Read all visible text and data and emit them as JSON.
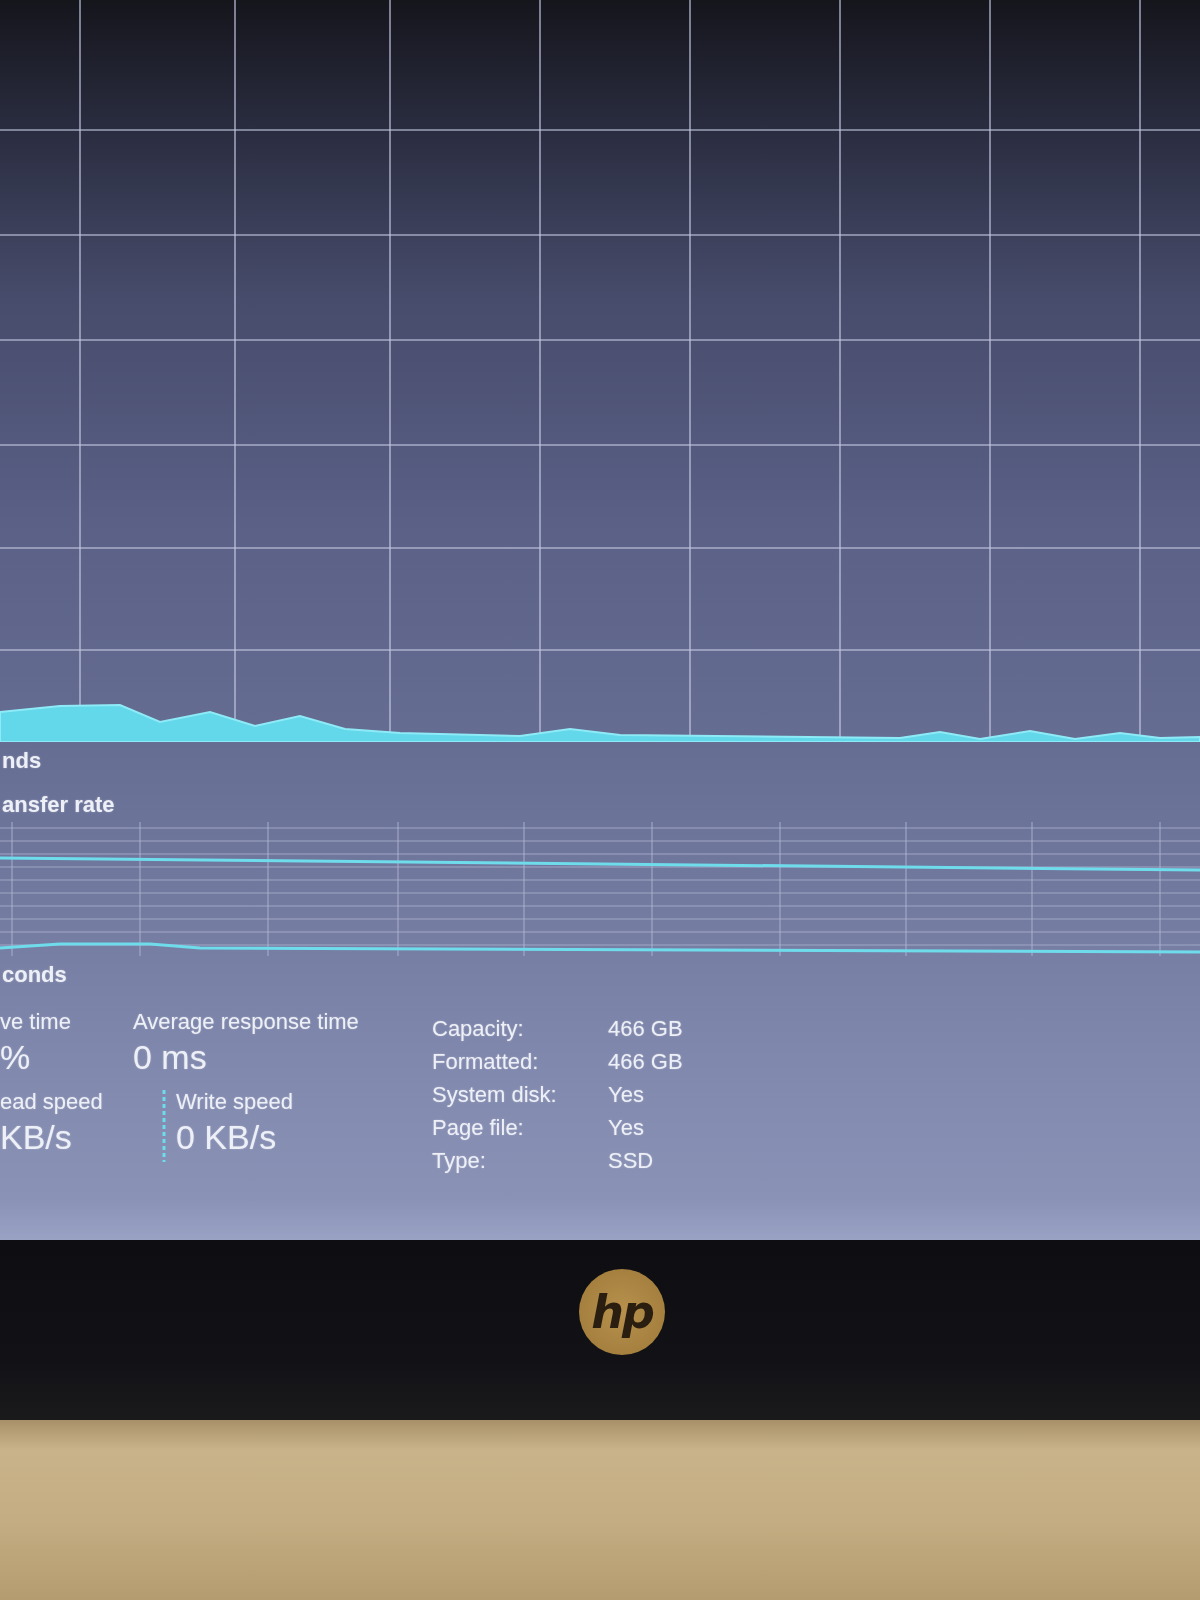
{
  "active_time_graph": {
    "caption": "nds"
  },
  "transfer_rate_graph": {
    "title": "ansfer rate",
    "caption": "conds"
  },
  "metrics": [
    {
      "label": "ve time",
      "value": "%"
    },
    {
      "label": "Average response time",
      "value": "0 ms"
    }
  ],
  "speeds": [
    {
      "label": "ead speed",
      "value": "KB/s",
      "kind": "plain"
    },
    {
      "label": "Write speed",
      "value": "0 KB/s",
      "kind": "dashed"
    }
  ],
  "properties": [
    {
      "label": "Capacity:",
      "value": "466 GB"
    },
    {
      "label": "Formatted:",
      "value": "466 GB"
    },
    {
      "label": "System disk:",
      "value": "Yes"
    },
    {
      "label": "Page file:",
      "value": "Yes"
    },
    {
      "label": "Type:",
      "value": "SSD"
    }
  ],
  "bezel": {
    "logo": "hp"
  }
}
